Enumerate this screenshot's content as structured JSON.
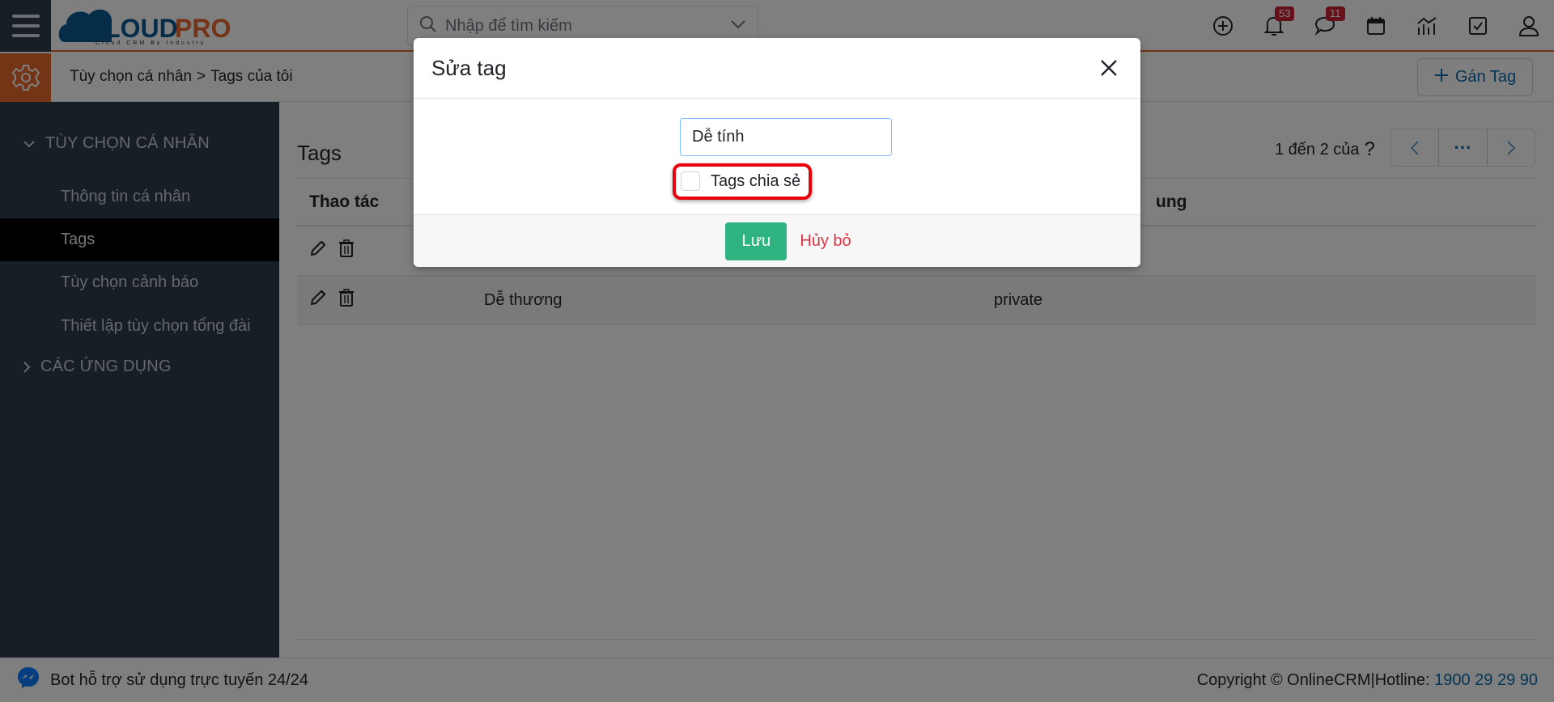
{
  "header": {
    "logo_text_1": "CLOUD",
    "logo_text_2": "PRO",
    "logo_tagline": "Cloud CRM By Industry",
    "search_placeholder": "Nhập để tìm kiếm",
    "notifications_count": "53",
    "messages_count": "11"
  },
  "subheader": {
    "breadcrumb": [
      "Tùy chọn cá nhân",
      "Tags của tôi"
    ],
    "breadcrumb_separator": ">",
    "assign_tag_label": "Gán Tag"
  },
  "sidebar": {
    "group1_label": "TÙY CHỌN CÁ NHÂN",
    "items": [
      {
        "label": "Thông tin cá nhân"
      },
      {
        "label": "Tags",
        "active": true
      },
      {
        "label": "Tùy chọn cảnh báo"
      },
      {
        "label": "Thiết lập tùy chọn tổng đài"
      }
    ],
    "group2_label": "CÁC ỨNG DỤNG"
  },
  "main": {
    "title": "Tags",
    "pager_text": "1 đến 2 của",
    "pager_unknown": "?",
    "pager_more": "···",
    "columns": {
      "actions": "Thao tác",
      "share_partial": "ung"
    },
    "rows": [
      {
        "name": "",
        "share": ""
      },
      {
        "name": "Dễ thương",
        "share": "private"
      }
    ]
  },
  "footer": {
    "bot_text": "Bot hỗ trợ sử dụng trực tuyến 24/24",
    "copyright": "Copyright © OnlineCRM|Hotline: ",
    "hotline": "1900 29 29 90"
  },
  "modal": {
    "title": "Sửa tag",
    "tag_value": "Dễ tính",
    "share_checkbox_label": "Tags chia sẻ",
    "share_checked": false,
    "save_label": "Lưu",
    "cancel_label": "Hủy bỏ"
  },
  "colors": {
    "brand_orange": "#e8692c",
    "brand_blue": "#0b5a93",
    "save_green": "#2fb380",
    "cancel_red": "#dc3545",
    "highlight_red": "#e8000b"
  }
}
